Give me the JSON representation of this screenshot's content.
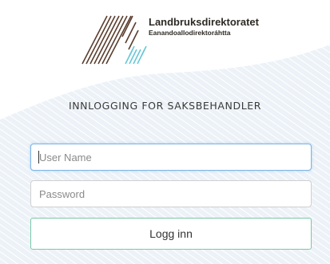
{
  "brand": {
    "title": "Landbruksdirektoratet",
    "subtitle": "Eanandoallodirektoráhtta",
    "logo_icon": "landbruksdirektoratet-logo-icon",
    "colors": {
      "dark_stripes": "#5a3d2e",
      "light_stripes": "#67c8d8"
    }
  },
  "login": {
    "heading": "INNLOGGING FOR SAKSBEHANDLER",
    "username_placeholder": "User Name",
    "password_placeholder": "Password",
    "submit_label": "Logg inn"
  },
  "colors": {
    "focus_border": "#7fb4e6",
    "button_border": "#7cc7a6",
    "background_band": "#eaf1f6"
  }
}
